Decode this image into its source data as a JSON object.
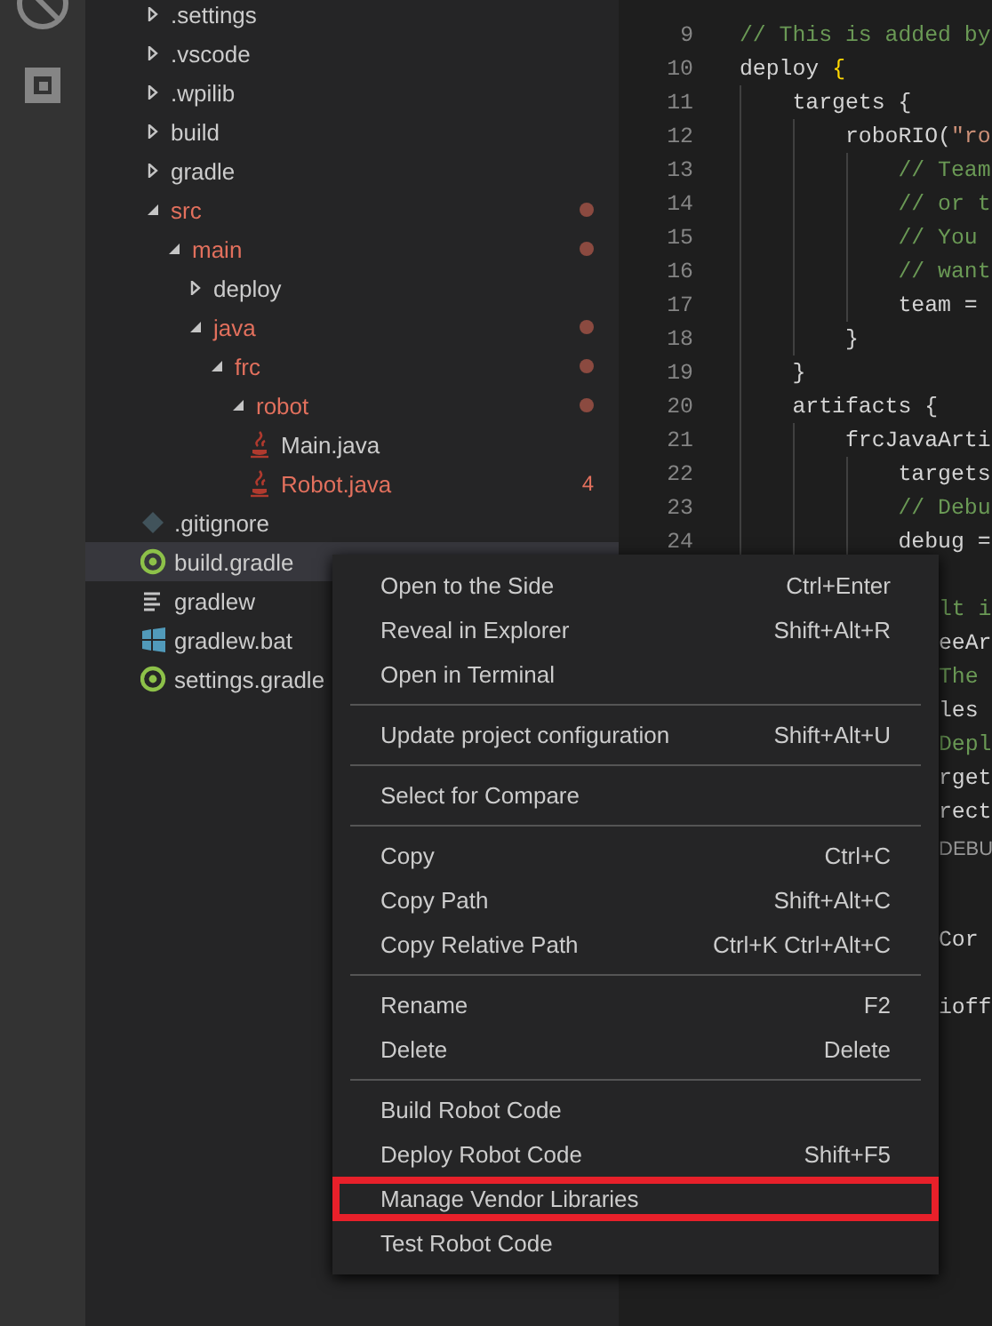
{
  "activity_bar": [
    {
      "kind": "debug"
    },
    {
      "kind": "extensions"
    }
  ],
  "explorer": {
    "items": [
      {
        "name": ".settings",
        "kind": "folder",
        "expanded": false,
        "modified": false,
        "selected": false
      },
      {
        "name": ".vscode",
        "kind": "folder",
        "expanded": false,
        "modified": false,
        "selected": false
      },
      {
        "name": ".wpilib",
        "kind": "folder",
        "expanded": false,
        "modified": false,
        "selected": false
      },
      {
        "name": "build",
        "kind": "folder",
        "expanded": false,
        "modified": false,
        "selected": false
      },
      {
        "name": "gradle",
        "kind": "folder",
        "expanded": false,
        "modified": false,
        "selected": false
      },
      {
        "name": "src",
        "kind": "folder",
        "expanded": true,
        "modified": true,
        "selected": false,
        "children": [
          {
            "name": "main",
            "kind": "folder",
            "expanded": true,
            "modified": true,
            "selected": false,
            "children": [
              {
                "name": "deploy",
                "kind": "folder",
                "expanded": false,
                "modified": false,
                "selected": false
              },
              {
                "name": "java",
                "kind": "folder",
                "expanded": true,
                "modified": true,
                "selected": false,
                "children": [
                  {
                    "name": "frc",
                    "kind": "folder",
                    "expanded": true,
                    "modified": true,
                    "selected": false,
                    "children": [
                      {
                        "name": "robot",
                        "kind": "folder",
                        "expanded": true,
                        "modified": true,
                        "selected": false,
                        "children": [
                          {
                            "name": "Main.java",
                            "kind": "java",
                            "modified": false,
                            "selected": false
                          },
                          {
                            "name": "Robot.java",
                            "kind": "java",
                            "modified": true,
                            "selected": false,
                            "problems": "4"
                          }
                        ]
                      }
                    ]
                  }
                ]
              }
            ]
          }
        ]
      },
      {
        "name": ".gitignore",
        "kind": "git",
        "modified": false,
        "selected": false
      },
      {
        "name": "build.gradle",
        "kind": "gradle",
        "modified": false,
        "selected": true
      },
      {
        "name": "gradlew",
        "kind": "text",
        "modified": false,
        "selected": false
      },
      {
        "name": "gradlew.bat",
        "kind": "windows",
        "modified": false,
        "selected": false
      },
      {
        "name": "settings.gradle",
        "kind": "gradle",
        "modified": false,
        "selected": false
      }
    ]
  },
  "editor": {
    "lines": [
      {
        "num": "9",
        "segments": [
          {
            "text": "// This is added by",
            "kind": "comment"
          }
        ]
      },
      {
        "num": "10",
        "segments": [
          {
            "text": "deploy ",
            "kind": "plain"
          },
          {
            "text": "{",
            "kind": "brace"
          }
        ]
      },
      {
        "num": "11",
        "segments": [
          {
            "text": "    targets ",
            "kind": "plain"
          },
          {
            "text": "{",
            "kind": "brace2"
          }
        ]
      },
      {
        "num": "12",
        "segments": [
          {
            "text": "        roboRIO(",
            "kind": "plain"
          },
          {
            "text": "\"ro",
            "kind": "string"
          }
        ]
      },
      {
        "num": "13",
        "segments": [
          {
            "text": "            // Team",
            "kind": "comment"
          }
        ]
      },
      {
        "num": "14",
        "segments": [
          {
            "text": "            // or t",
            "kind": "comment"
          }
        ]
      },
      {
        "num": "15",
        "segments": [
          {
            "text": "            // You",
            "kind": "comment"
          }
        ]
      },
      {
        "num": "16",
        "segments": [
          {
            "text": "            // want",
            "kind": "comment"
          }
        ]
      },
      {
        "num": "17",
        "segments": [
          {
            "text": "            team =",
            "kind": "plain"
          }
        ]
      },
      {
        "num": "18",
        "segments": [
          {
            "text": "        }",
            "kind": "brace3"
          }
        ]
      },
      {
        "num": "19",
        "segments": [
          {
            "text": "    }",
            "kind": "brace2"
          }
        ]
      },
      {
        "num": "20",
        "segments": [
          {
            "text": "    artifacts ",
            "kind": "plain"
          },
          {
            "text": "{",
            "kind": "brace2"
          }
        ]
      },
      {
        "num": "21",
        "segments": [
          {
            "text": "        frcJavaArti",
            "kind": "plain"
          }
        ]
      },
      {
        "num": "22",
        "segments": [
          {
            "text": "            targets",
            "kind": "plain"
          }
        ]
      },
      {
        "num": "23",
        "segments": [
          {
            "text": "            // Debu",
            "kind": "comment"
          }
        ]
      },
      {
        "num": "24",
        "segments": [
          {
            "text": "            debug =",
            "kind": "plain"
          }
        ]
      }
    ],
    "lines_behind_menu": [
      {
        "kind": "blank"
      },
      {
        "kind": "comment",
        "text": "lt i"
      },
      {
        "kind": "plain",
        "text": "eeAr"
      },
      {
        "kind": "comment",
        "text": "The"
      },
      {
        "kind": "plain",
        "text": "les"
      },
      {
        "kind": "comment",
        "text": "Depl"
      },
      {
        "kind": "plain",
        "text": "rget"
      },
      {
        "kind": "plain",
        "text": "rect"
      },
      {
        "kind": "codelens",
        "text": "DEBU"
      },
      {
        "kind": "blank"
      },
      {
        "kind": "plain",
        "text": "Cor"
      },
      {
        "kind": "blank"
      },
      {
        "kind": "plain",
        "text": "ioff"
      }
    ]
  },
  "context_menu": {
    "groups": [
      [
        {
          "label": "Open to the Side",
          "shortcut": "Ctrl+Enter",
          "highlighted": false
        },
        {
          "label": "Reveal in Explorer",
          "shortcut": "Shift+Alt+R",
          "highlighted": false
        },
        {
          "label": "Open in Terminal",
          "highlighted": false
        }
      ],
      [
        {
          "label": "Update project configuration",
          "shortcut": "Shift+Alt+U",
          "highlighted": false
        }
      ],
      [
        {
          "label": "Select for Compare",
          "highlighted": false
        }
      ],
      [
        {
          "label": "Copy",
          "shortcut": "Ctrl+C",
          "highlighted": false
        },
        {
          "label": "Copy Path",
          "shortcut": "Shift+Alt+C",
          "highlighted": false
        },
        {
          "label": "Copy Relative Path",
          "shortcut": "Ctrl+K Ctrl+Alt+C",
          "highlighted": false
        }
      ],
      [
        {
          "label": "Rename",
          "shortcut": "F2",
          "highlighted": false
        },
        {
          "label": "Delete",
          "shortcut": "Delete",
          "highlighted": false
        }
      ],
      [
        {
          "label": "Build Robot Code",
          "highlighted": false
        },
        {
          "label": "Deploy Robot Code",
          "shortcut": "Shift+F5",
          "highlighted": false
        },
        {
          "label": "Manage Vendor Libraries",
          "highlighted": true
        },
        {
          "label": "Test Robot Code",
          "highlighted": false
        }
      ]
    ]
  }
}
